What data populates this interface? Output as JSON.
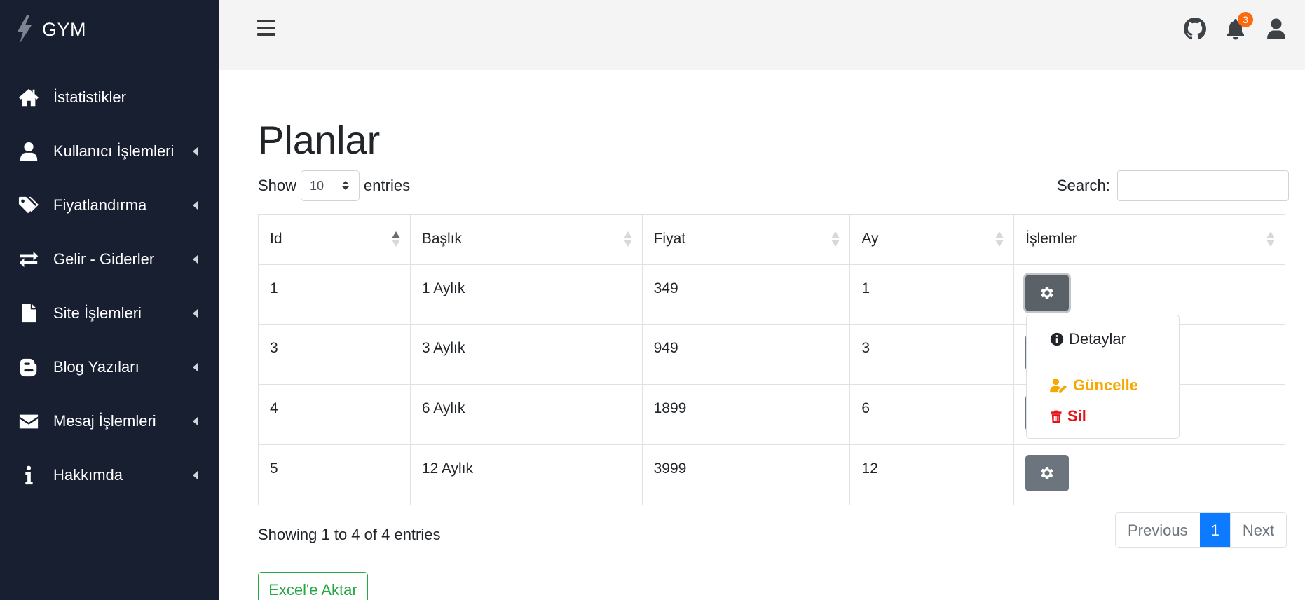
{
  "brand": {
    "name": "GYM",
    "icon": "bolt-icon"
  },
  "sidebar": {
    "items": [
      {
        "label": "İstatistikler",
        "icon": "home-icon",
        "has_submenu": false
      },
      {
        "label": "Kullanıcı İşlemleri",
        "icon": "user-icon",
        "has_submenu": true
      },
      {
        "label": "Fiyatlandırma",
        "icon": "tags-icon",
        "has_submenu": true
      },
      {
        "label": "Gelir - Giderler",
        "icon": "exchange-icon",
        "has_submenu": true
      },
      {
        "label": "Site İşlemleri",
        "icon": "file-icon",
        "has_submenu": true
      },
      {
        "label": "Blog Yazıları",
        "icon": "blogger-icon",
        "has_submenu": true
      },
      {
        "label": "Mesaj İşlemleri",
        "icon": "envelope-icon",
        "has_submenu": true
      },
      {
        "label": "Hakkımda",
        "icon": "info-icon",
        "has_submenu": true
      }
    ]
  },
  "topbar": {
    "notification_count": "3"
  },
  "page": {
    "title": "Planlar"
  },
  "table_controls": {
    "show_label": "Show",
    "entries_label": "entries",
    "length_value": "10",
    "search_label": "Search:",
    "search_value": ""
  },
  "table": {
    "columns": [
      "Id",
      "Başlık",
      "Fiyat",
      "Ay",
      "İşlemler"
    ],
    "rows": [
      {
        "id": "1",
        "title": "1 Aylık",
        "price": "349",
        "months": "1"
      },
      {
        "id": "3",
        "title": "3 Aylık",
        "price": "949",
        "months": "3"
      },
      {
        "id": "4",
        "title": "6 Aylık",
        "price": "1899",
        "months": "6"
      },
      {
        "id": "5",
        "title": "12 Aylık",
        "price": "3999",
        "months": "12"
      }
    ]
  },
  "dropdown": {
    "details": "Detaylar",
    "update": "Güncelle",
    "delete": "Sil"
  },
  "footer": {
    "info": "Showing 1 to 4 of 4 entries",
    "previous": "Previous",
    "current_page": "1",
    "next": "Next",
    "excel_button": "Excel'e Aktar"
  },
  "colors": {
    "sidebar_bg": "#171f31",
    "topbar_bg": "#f4f4f4",
    "primary": "#0d7bff",
    "success": "#28a745",
    "warning": "#f6a800",
    "danger": "#e3131a",
    "badge": "#fd6a0d",
    "gear_button": "#6c757d"
  }
}
